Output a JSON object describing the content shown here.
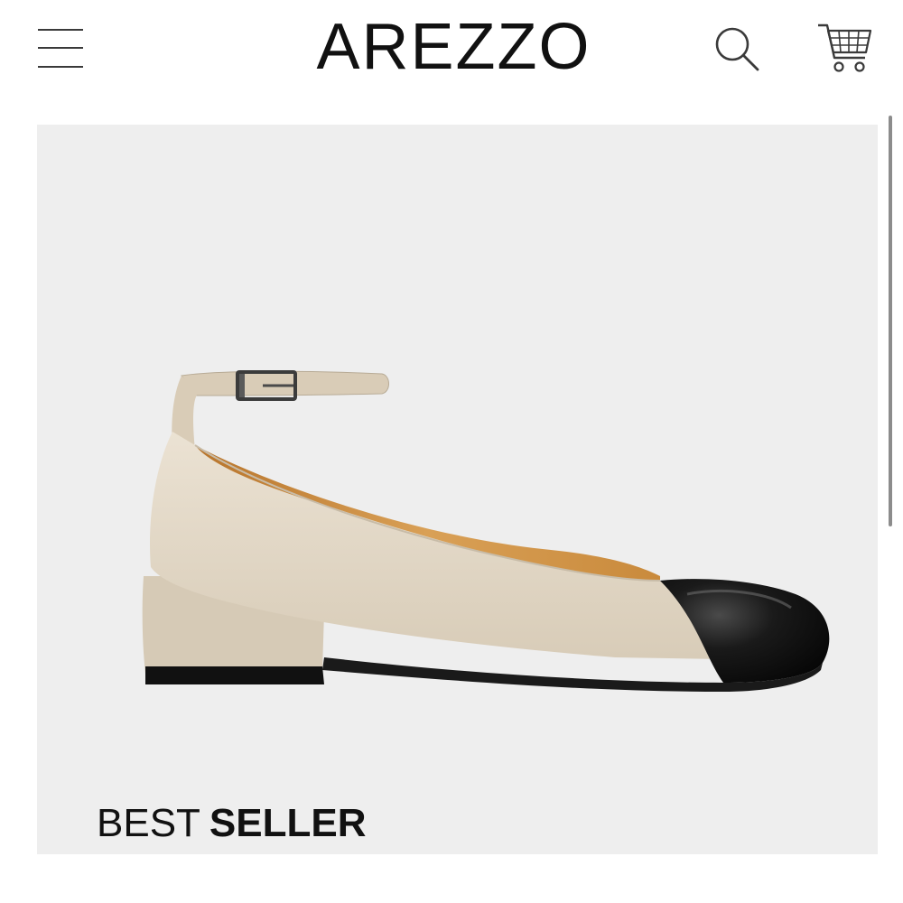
{
  "header": {
    "brand": "AREZZO",
    "menu_icon": "hamburger-menu-icon",
    "search_icon": "search-icon",
    "cart_icon": "shopping-cart-icon"
  },
  "hero": {
    "badge_light": "BEST",
    "badge_strong": "SELLER",
    "background_color": "#eeeeee",
    "product": {
      "image": "shoe-image",
      "upper_color": "#e3d9c8",
      "toe_cap_color": "#141414",
      "lining_color": "#c98a3c"
    }
  },
  "colors": {
    "text": "#111111",
    "icon": "#3a3a3a"
  }
}
